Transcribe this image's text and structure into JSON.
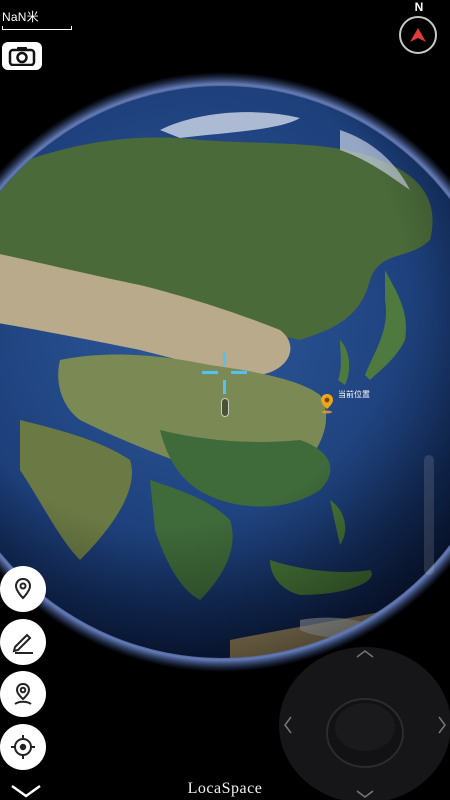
{
  "map": {
    "scale_text": "NaN米",
    "compass_label": "N",
    "current_location_label": "当前位置",
    "brand": "LocaSpace"
  },
  "toolbar": {
    "camera": "camera-icon",
    "buttons": [
      {
        "icon": "location-pin-icon"
      },
      {
        "icon": "pencil-icon"
      },
      {
        "icon": "route-pin-icon"
      },
      {
        "icon": "target-icon"
      }
    ]
  },
  "colors": {
    "ocean": "#1d3f7a",
    "land_green": "#4a6a3a",
    "land_tan": "#b8aa8a",
    "atmosphere": "#6d8fe0",
    "pin": "#f0a41a",
    "crosshair": "#4fc3f7"
  }
}
